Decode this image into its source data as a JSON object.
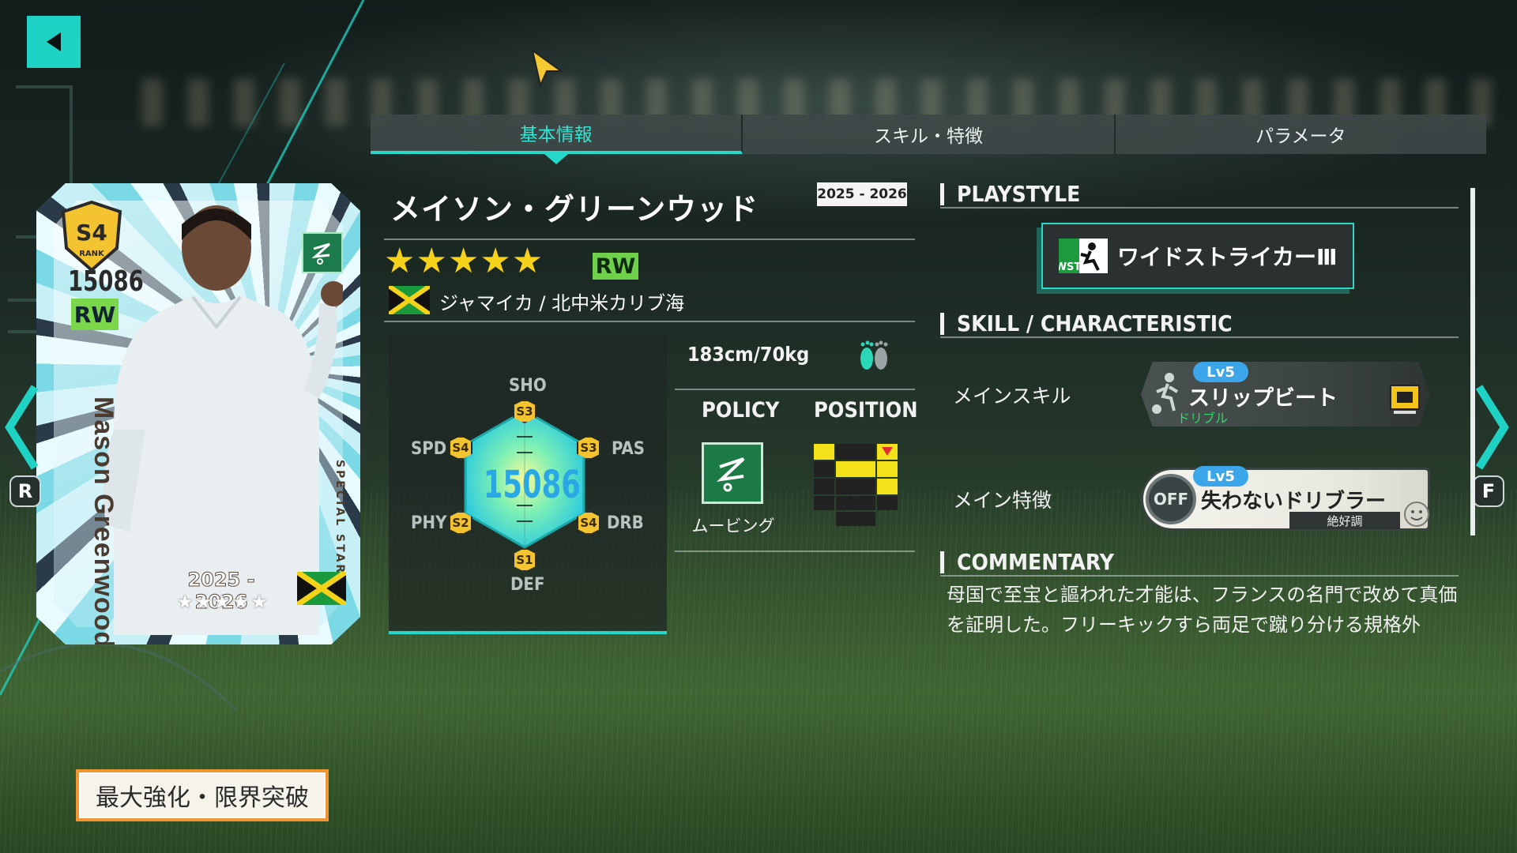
{
  "tabs": [
    {
      "label": "基本情報",
      "active": true
    },
    {
      "label": "スキル・特徴",
      "active": false
    },
    {
      "label": "パラメータ",
      "active": false
    }
  ],
  "card": {
    "rank": "S4",
    "rank_sub": "RANK",
    "rating": "15086",
    "position": "RW",
    "name": "Mason Greenwood",
    "special_label": "SPECIAL STAR",
    "season": "2025 - 2026",
    "stars": "★★★★★"
  },
  "navigation": {
    "prev_key": "R",
    "next_key": "F"
  },
  "player": {
    "name": "メイソン・グリーンウッド",
    "season": "2025 - 2026",
    "stars": "★★★★★",
    "position": "RW",
    "nationality": "ジャマイカ / 北中米カリブ海",
    "height_weight": "183cm/70kg",
    "overall": "15086"
  },
  "stats": [
    {
      "key": "SHO",
      "rank": "S3"
    },
    {
      "key": "PAS",
      "rank": "S3"
    },
    {
      "key": "DRB",
      "rank": "S4"
    },
    {
      "key": "DEF",
      "rank": "S1"
    },
    {
      "key": "PHY",
      "rank": "S2"
    },
    {
      "key": "SPD",
      "rank": "S4"
    }
  ],
  "policy": {
    "header": "POLICY",
    "label": "ムービング"
  },
  "position_map": {
    "header": "POSITION"
  },
  "playstyle": {
    "title": "PLAYSTYLE",
    "icon_text": "WST",
    "name": "ワイドストライカーⅢ"
  },
  "skills": {
    "title": "SKILL / CHARACTERISTIC",
    "main_skill_label": "メインスキル",
    "main_skill_level": "Lv5",
    "main_skill_name": "スリップビート",
    "main_skill_type": "ドリブル",
    "main_trait_label": "メイン特徴",
    "main_trait_level": "Lv5",
    "main_trait_status": "OFF",
    "main_trait_name": "失わないドリブラー",
    "main_trait_condition": "絶好調"
  },
  "commentary": {
    "title": "COMMENTARY",
    "text": "母国で至宝と謳われた才能は、フランスの名門で改めて真価を証明した。フリーキックすら両足で蹴り分ける規格外"
  },
  "enhance_button": "最大強化・限界突破",
  "colors": {
    "accent": "#25d8c8",
    "star": "#f7d21a",
    "position_green": "#6fd14a",
    "enhance_border": "#f09532",
    "rank_gold": "#f4c430"
  }
}
